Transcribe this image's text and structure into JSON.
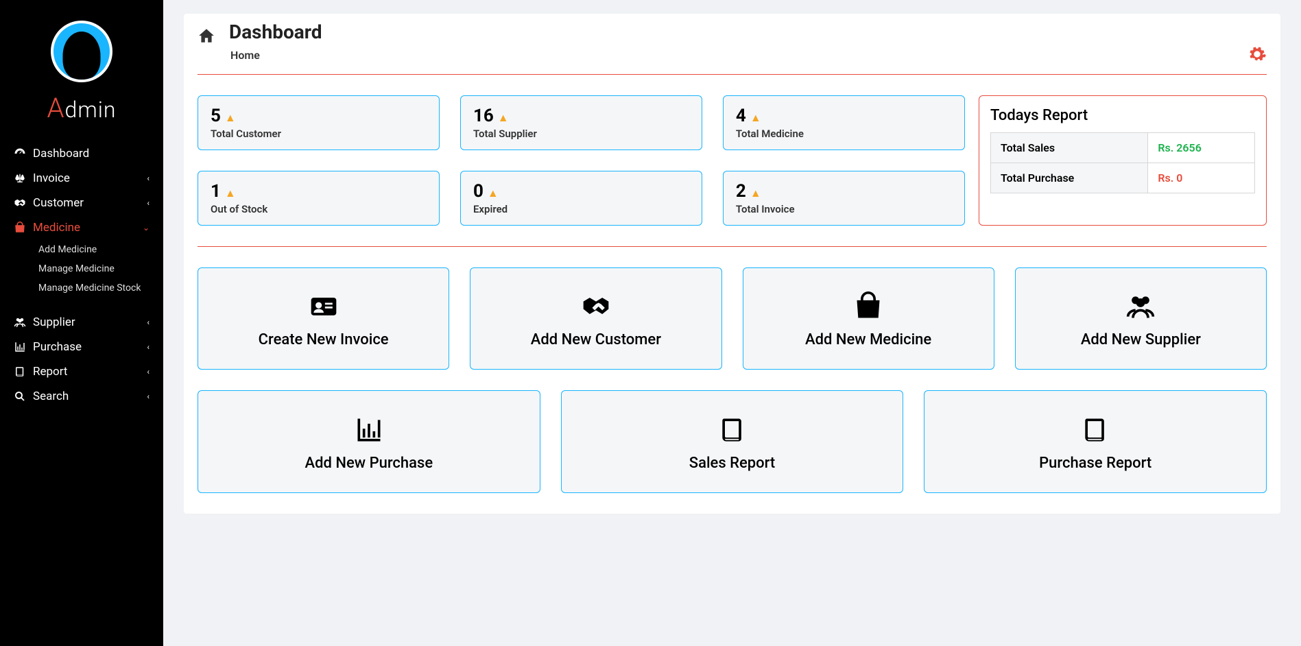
{
  "user": {
    "label_first": "A",
    "label_rest": "dmin"
  },
  "sidebar": {
    "items": [
      {
        "label": "Dashboard",
        "icon": "dashboard-icon",
        "expandable": false
      },
      {
        "label": "Invoice",
        "icon": "scale-icon",
        "expandable": true
      },
      {
        "label": "Customer",
        "icon": "handshake-icon",
        "expandable": true
      },
      {
        "label": "Medicine",
        "icon": "bag-icon",
        "expandable": true,
        "active": true,
        "sub": [
          "Add Medicine",
          "Manage Medicine",
          "Manage Medicine Stock"
        ]
      },
      {
        "label": "Supplier",
        "icon": "users-icon",
        "expandable": true
      },
      {
        "label": "Purchase",
        "icon": "chart-icon",
        "expandable": true
      },
      {
        "label": "Report",
        "icon": "book-icon",
        "expandable": true
      },
      {
        "label": "Search",
        "icon": "search-icon",
        "expandable": true
      }
    ]
  },
  "header": {
    "title": "Dashboard",
    "breadcrumb": "Home"
  },
  "stats": [
    {
      "value": "5",
      "label": "Total Customer"
    },
    {
      "value": "16",
      "label": "Total Supplier"
    },
    {
      "value": "4",
      "label": "Total Medicine"
    },
    {
      "value": "1",
      "label": "Out of Stock"
    },
    {
      "value": "0",
      "label": "Expired"
    },
    {
      "value": "2",
      "label": "Total Invoice"
    }
  ],
  "report": {
    "title": "Todays Report",
    "rows": [
      {
        "label": "Total Sales",
        "value": "Rs. 2656",
        "cls": "val-green"
      },
      {
        "label": "Total Purchase",
        "value": "Rs. 0",
        "cls": "val-red"
      }
    ]
  },
  "actions": [
    {
      "label": "Create New Invoice",
      "icon": "id-card-icon"
    },
    {
      "label": "Add New Customer",
      "icon": "handshake-icon"
    },
    {
      "label": "Add New Medicine",
      "icon": "shopping-bag-icon"
    },
    {
      "label": "Add New Supplier",
      "icon": "users-icon"
    },
    {
      "label": "Add New Purchase",
      "icon": "chart-icon"
    },
    {
      "label": "Sales Report",
      "icon": "book-icon"
    },
    {
      "label": "Purchase Report",
      "icon": "book-icon"
    }
  ]
}
